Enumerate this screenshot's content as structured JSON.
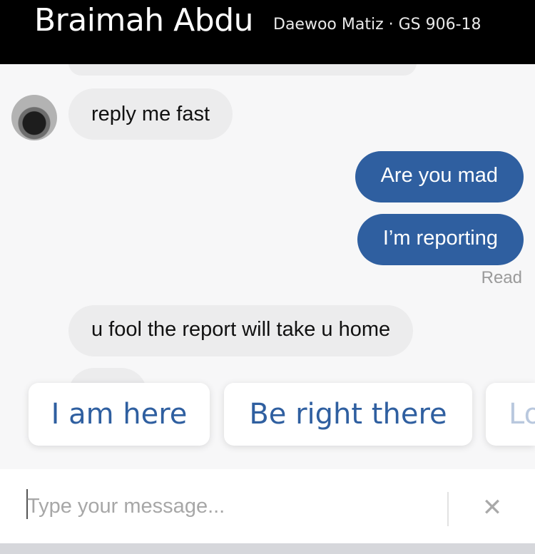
{
  "header": {
    "contact_name": "Braimah Abdu",
    "vehicle_info": "Daewoo Matiz · GS 906-18"
  },
  "messages": [
    {
      "direction": "incoming",
      "text": "reply me  fast"
    },
    {
      "direction": "outgoing",
      "text": "Are you mad"
    },
    {
      "direction": "outgoing",
      "text": "I’m reporting"
    },
    {
      "direction": "incoming",
      "text": "u fool  the  report will take u home"
    }
  ],
  "read_status": "Read",
  "quick_replies": [
    "I am here",
    "Be right there",
    "Lo"
  ],
  "composer": {
    "placeholder": "Type your message...",
    "clear_icon": "close-icon"
  },
  "colors": {
    "header_bg": "#000000",
    "outgoing_bubble": "#2f5fa0",
    "incoming_bubble": "#ececed",
    "quick_reply_text": "#2f5fa0"
  }
}
